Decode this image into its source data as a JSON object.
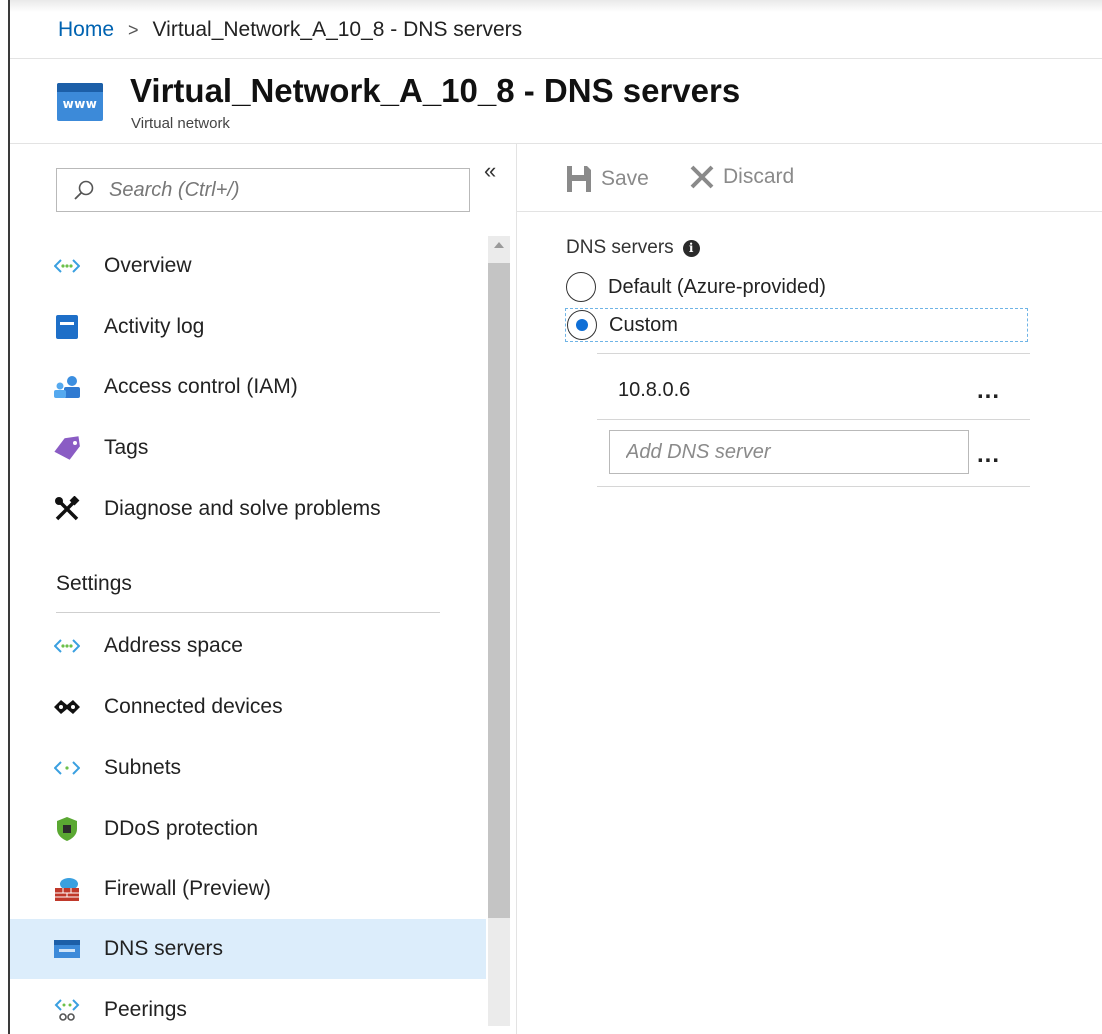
{
  "breadcrumb": {
    "home": "Home",
    "separator": ">",
    "current": "Virtual_Network_A_10_8 - DNS servers"
  },
  "header": {
    "title": "Virtual_Network_A_10_8 - DNS servers",
    "subtitle": "Virtual network",
    "icon_text": "www",
    "icon_name": "virtual-network-icon"
  },
  "sidebar": {
    "collapse_glyph": "«",
    "search_placeholder": "Search (Ctrl+/)",
    "items": [
      {
        "label": "Overview",
        "icon": "network-arrows-icon"
      },
      {
        "label": "Activity log",
        "icon": "activity-log-icon"
      },
      {
        "label": "Access control (IAM)",
        "icon": "people-icon"
      },
      {
        "label": "Tags",
        "icon": "tag-icon"
      },
      {
        "label": "Diagnose and solve problems",
        "icon": "tools-icon"
      }
    ],
    "section_title": "Settings",
    "settings_items": [
      {
        "label": "Address space",
        "icon": "network-arrows-icon"
      },
      {
        "label": "Connected devices",
        "icon": "plug-icon"
      },
      {
        "label": "Subnets",
        "icon": "brackets-icon"
      },
      {
        "label": "DDoS protection",
        "icon": "shield-icon"
      },
      {
        "label": "Firewall (Preview)",
        "icon": "firewall-icon"
      },
      {
        "label": "DNS servers",
        "icon": "dns-icon",
        "selected": true
      },
      {
        "label": "Peerings",
        "icon": "peerings-icon"
      }
    ]
  },
  "toolbar": {
    "save_label": "Save",
    "discard_label": "Discard"
  },
  "dns": {
    "label": "DNS servers",
    "info_glyph": "i",
    "options": [
      {
        "label": "Default (Azure-provided)",
        "selected": false
      },
      {
        "label": "Custom",
        "selected": true
      }
    ],
    "servers": [
      "10.8.0.6"
    ],
    "add_placeholder": "Add DNS server",
    "more_glyph": "..."
  },
  "colors": {
    "accent": "#0063b1",
    "selected_bg": "#dcedfb",
    "radio_dot": "#0f6fd6"
  }
}
